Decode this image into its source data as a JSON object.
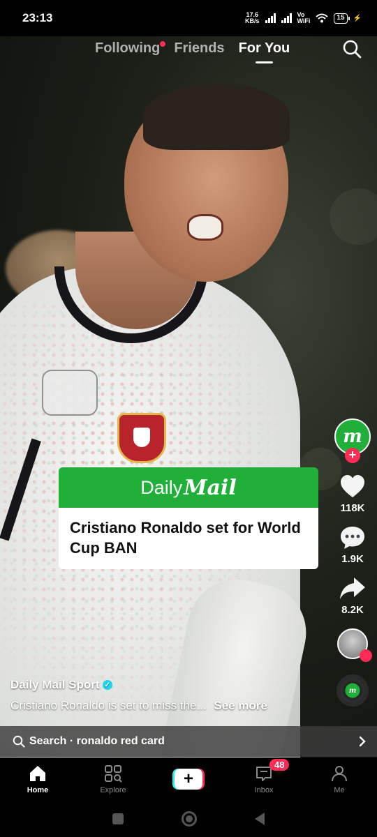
{
  "status": {
    "time": "23:13",
    "net_speed_value": "17.6",
    "net_speed_unit": "KB/s",
    "vo_label": "Vo",
    "wifi_label": "WiFi",
    "battery": "15"
  },
  "top_tabs": {
    "following": "Following",
    "friends": "Friends",
    "for_you": "For You"
  },
  "card": {
    "brand_daily": "Daily",
    "brand_mail": "Mail",
    "headline": "Cristiano Ronaldo set for World Cup BAN"
  },
  "side_actions": {
    "avatar_letter": "m",
    "follow_symbol": "+",
    "likes": "118K",
    "comments": "1.9K",
    "shares": "8.2K",
    "disc_letter": "m"
  },
  "post": {
    "author": "Daily Mail Sport",
    "verified_mark": "✓",
    "description": "Cristiano Ronaldo is set to miss the...",
    "see_more": "See more"
  },
  "search_suggestion": {
    "prefix": "Search",
    "separator": " · ",
    "query": "ronaldo red card"
  },
  "bottom_nav": {
    "home": "Home",
    "explore": "Explore",
    "create_symbol": "+",
    "inbox": "Inbox",
    "inbox_badge": "48",
    "me": "Me"
  },
  "colors": {
    "brand_green": "#20b03a",
    "accent_red": "#fe2c55",
    "accent_cyan": "#25f4ee"
  },
  "icons": [
    "search-icon",
    "heart-icon",
    "comment-icon",
    "share-icon",
    "home-icon",
    "explore-icon",
    "inbox-icon",
    "profile-icon",
    "chevron-right-icon"
  ]
}
